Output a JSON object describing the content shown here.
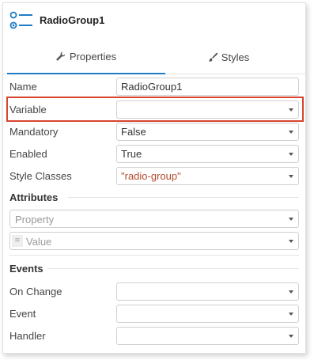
{
  "header": {
    "title": "RadioGroup1",
    "icon": "radio-group-icon"
  },
  "tabs": [
    {
      "label": "Properties",
      "icon": "wrench-icon",
      "active": true
    },
    {
      "label": "Styles",
      "icon": "brush-icon",
      "active": false
    }
  ],
  "properties": {
    "name": {
      "label": "Name",
      "value": "RadioGroup1"
    },
    "variable": {
      "label": "Variable",
      "value": ""
    },
    "mandatory": {
      "label": "Mandatory",
      "value": "False"
    },
    "enabled": {
      "label": "Enabled",
      "value": "True"
    },
    "style_classes": {
      "label": "Style Classes",
      "value": "\"radio-group\""
    }
  },
  "attributes": {
    "title": "Attributes",
    "property_placeholder": "Property",
    "value_prefix": "=",
    "value_placeholder": "Value"
  },
  "events": {
    "title": "Events",
    "on_change": {
      "label": "On Change",
      "value": ""
    },
    "event": {
      "label": "Event",
      "value": ""
    },
    "handler": {
      "label": "Handler",
      "value": ""
    }
  },
  "colors": {
    "accent": "#1f7cc6",
    "highlight": "#d8452f",
    "string_value": "#b34b2e"
  }
}
